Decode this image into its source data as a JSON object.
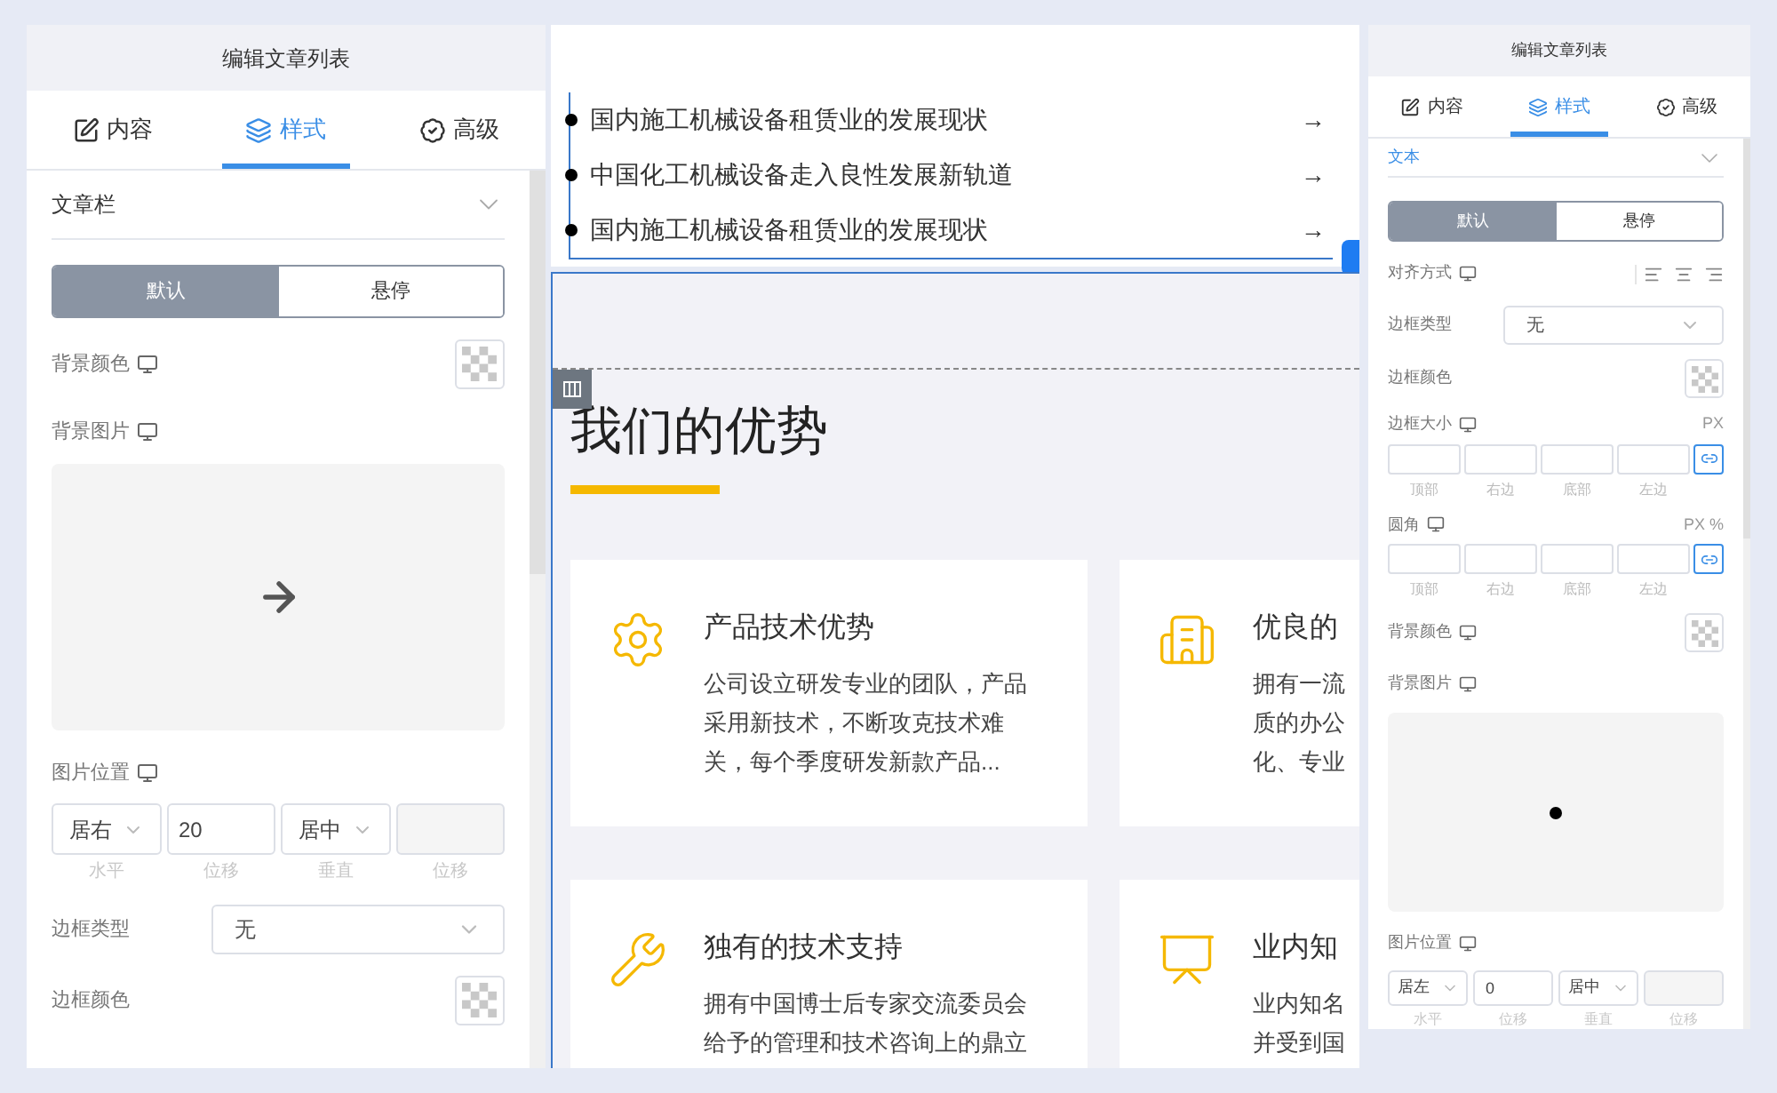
{
  "left_panel": {
    "title": "编辑文章列表",
    "tabs": [
      {
        "label": "内容",
        "selected": false,
        "kind": "edit"
      },
      {
        "label": "样式",
        "selected": true,
        "kind": "style"
      },
      {
        "label": "高级",
        "selected": false,
        "kind": "advanced"
      }
    ],
    "section": {
      "title": "文章栏",
      "active": false
    },
    "state_toggle": [
      {
        "label": "默认",
        "selected": true
      },
      {
        "label": "悬停",
        "selected": false
      }
    ],
    "rows": [
      {
        "kind": "color",
        "label": "背景颜色",
        "device_icon": true
      },
      {
        "kind": "image",
        "label": "背景图片",
        "device_icon": true,
        "preview": {
          "kind": "arrow"
        }
      },
      {
        "kind": "position",
        "label": "图片位置",
        "device_icon": true,
        "fields": [
          {
            "kind": "select",
            "value": "居右",
            "caption": "水平"
          },
          {
            "kind": "input",
            "value": "20",
            "caption": "位移"
          },
          {
            "kind": "select",
            "value": "居中",
            "caption": "垂直"
          },
          {
            "kind": "input",
            "caption": "位移"
          }
        ]
      },
      {
        "kind": "select",
        "label": "边框类型",
        "device_icon": false,
        "value": "无"
      },
      {
        "kind": "color",
        "label": "边框颜色",
        "device_icon": false
      }
    ]
  },
  "canvas": {
    "article_list": [
      {
        "title": "国内施工机械设备租赁业的发展现状",
        "arrow": "→"
      },
      {
        "title": "中国化工机械设备走入良性发展新轨道",
        "arrow": "→"
      },
      {
        "title": "国内施工机械设备租赁业的发展现状",
        "arrow": "→"
      }
    ],
    "heading": "我们的优势",
    "cards": [
      {
        "kind": "gear",
        "title": "产品技术优势",
        "lines": [
          "公司设立研发专业的团队，产品",
          "采用新技术，不断攻克技术难",
          "关，每个季度研发新款产品..."
        ]
      },
      {
        "kind": "building",
        "title": "优良的",
        "lines": [
          "拥有一流",
          "质的办公",
          "化、专业"
        ]
      },
      {
        "kind": "tools",
        "title": "独有的技术支持",
        "lines": [
          "拥有中国博士后专家交流委员会",
          "给予的管理和技术咨询上的鼎立"
        ]
      },
      {
        "kind": "board",
        "title": "业内知",
        "lines": [
          "业内知名",
          "并受到国"
        ]
      }
    ]
  },
  "right_panel": {
    "title": "编辑文章列表",
    "tabs": [
      {
        "label": "内容",
        "selected": false,
        "kind": "edit"
      },
      {
        "label": "样式",
        "selected": true,
        "kind": "style"
      },
      {
        "label": "高级",
        "selected": false,
        "kind": "advanced"
      }
    ],
    "section": {
      "title": "文本",
      "active": true
    },
    "state_toggle": [
      {
        "label": "默认",
        "selected": true
      },
      {
        "label": "悬停",
        "selected": false
      }
    ],
    "rows": [
      {
        "kind": "align",
        "label": "对齐方式",
        "device_icon": true
      },
      {
        "kind": "select",
        "label": "边框类型",
        "device_icon": false,
        "value": "无"
      },
      {
        "kind": "color",
        "label": "边框颜色",
        "device_icon": false
      },
      {
        "kind": "sides",
        "label": "边框大小",
        "device_icon": true,
        "unit": "PX",
        "captions": [
          "顶部",
          "右边",
          "底部",
          "左边"
        ]
      },
      {
        "kind": "sides",
        "label": "圆角",
        "device_icon": true,
        "unit": "PX %",
        "captions": [
          "顶部",
          "右边",
          "底部",
          "左边"
        ]
      },
      {
        "kind": "color",
        "label": "背景颜色",
        "device_icon": true
      },
      {
        "kind": "image",
        "label": "背景图片",
        "device_icon": true,
        "preview": {
          "kind": "dot"
        }
      },
      {
        "kind": "position",
        "label": "图片位置",
        "device_icon": true,
        "fields": [
          {
            "kind": "select",
            "value": "居左",
            "caption": "水平"
          },
          {
            "kind": "input",
            "value": "0",
            "caption": "位移"
          },
          {
            "kind": "select",
            "value": "居中",
            "caption": "垂直"
          },
          {
            "kind": "input",
            "caption": "位移"
          }
        ]
      }
    ]
  }
}
